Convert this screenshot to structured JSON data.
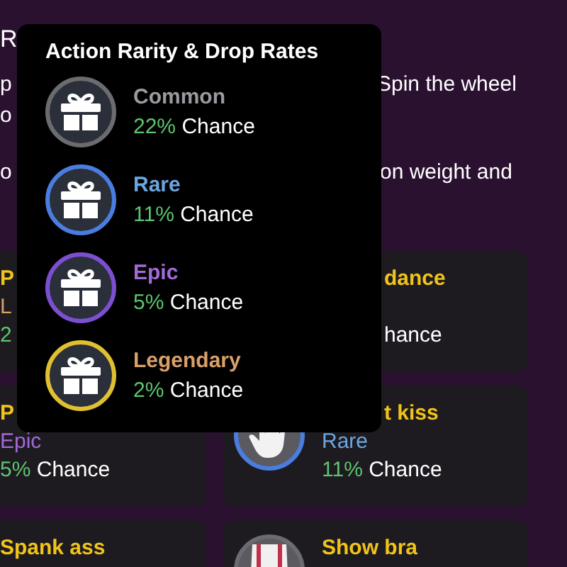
{
  "page": {
    "heading": "R",
    "intro_left": [
      "p",
      "o"
    ],
    "intro_right": "Spin the wheel",
    "rule_left": "o",
    "rule_right": "on weight and"
  },
  "cards": [
    {
      "title": "P",
      "rarity": {
        "label": "L",
        "kind": "legendary"
      },
      "chance": "2"
    },
    {
      "title": "dance",
      "title_cut": true,
      "chance_label": "hance",
      "chance_cut": true
    },
    {
      "title": "P",
      "rarity": {
        "label": "Epic",
        "kind": "epic"
      },
      "chance": "5%",
      "chance_label": "Chance"
    },
    {
      "title": "t kiss",
      "title_cut": true,
      "kind": "hand",
      "rarity": {
        "label": "Rare",
        "kind": "rare"
      },
      "chance": "11%",
      "chance_label": "Chance"
    },
    {
      "title": "Spank ass"
    },
    {
      "title": "Show bra",
      "kind": "figure"
    }
  ],
  "popover": {
    "title": "Action Rarity & Drop Rates",
    "tiers": [
      {
        "kind": "common",
        "label": "Common",
        "percent": "22%",
        "suffix": "Chance"
      },
      {
        "kind": "rare",
        "label": "Rare",
        "percent": "11%",
        "suffix": "Chance"
      },
      {
        "kind": "epic",
        "label": "Epic",
        "percent": "5%",
        "suffix": "Chance"
      },
      {
        "kind": "legendary",
        "label": "Legendary",
        "percent": "2%",
        "suffix": "Chance"
      }
    ]
  }
}
